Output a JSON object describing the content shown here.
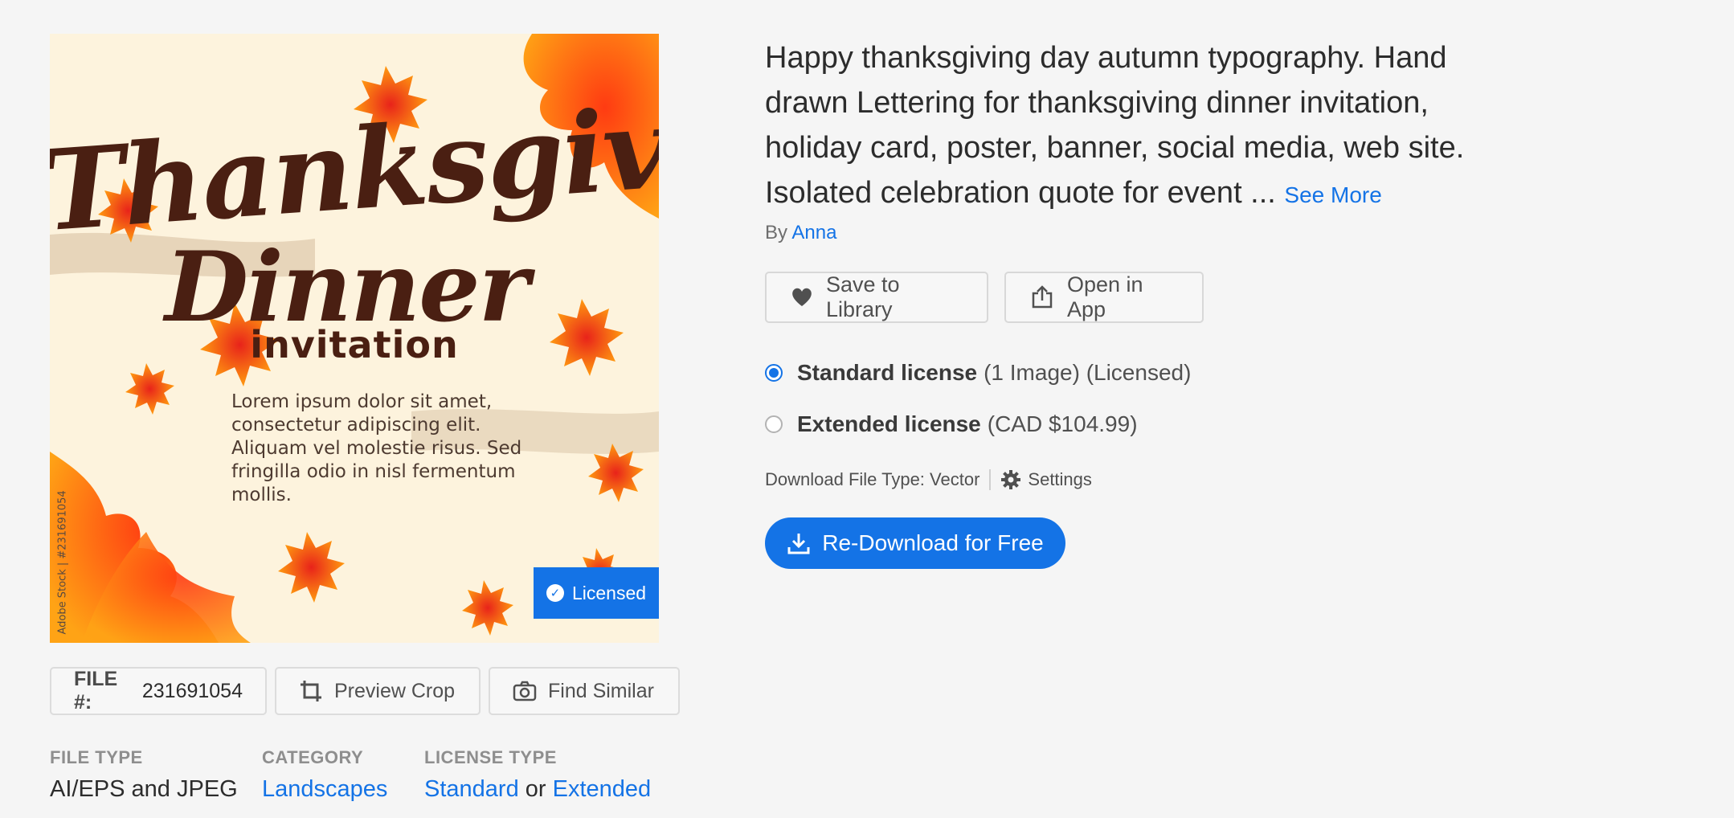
{
  "preview": {
    "headline_line1": "Thanksgiving",
    "headline_line2": "Dinner",
    "subheadline": "invitation",
    "lorem": "Lorem ipsum dolor sit amet, consectetur adipiscing elit. Aliquam vel molestie risus. Sed fringilla odio in nisl fermentum mollis.",
    "watermark": "Adobe Stock | #231691054",
    "badge_label": "Licensed",
    "badge_icon": "check-circle-icon"
  },
  "toolbar": {
    "file_label": "FILE #:",
    "file_number": "231691054",
    "preview_crop_label": "Preview Crop",
    "find_similar_label": "Find Similar"
  },
  "meta": {
    "file_type_heading": "FILE TYPE",
    "file_type_value": "AI/EPS and JPEG",
    "category_heading": "CATEGORY",
    "category_value": "Landscapes",
    "license_type_heading": "LICENSE TYPE",
    "license_standard": "Standard",
    "license_or": "or",
    "license_extended": "Extended"
  },
  "asset": {
    "title": "Happy thanksgiving day autumn typography. Hand drawn Lettering for thanksgiving dinner invitation, holiday card, poster, banner, social media, web site. Isolated celebration quote for event ...",
    "see_more": "See More",
    "by_label": "By",
    "author": "Anna"
  },
  "actions": {
    "save_label": "Save to Library",
    "open_label": "Open in App"
  },
  "licenses": [
    {
      "name": "Standard license",
      "detail": "(1 Image) (Licensed)",
      "selected": true
    },
    {
      "name": "Extended license",
      "detail": "(CAD $104.99)",
      "selected": false
    }
  ],
  "download": {
    "file_type_text": "Download File Type: Vector",
    "settings_label": "Settings",
    "redownload_label": "Re-Download for Free"
  },
  "colors": {
    "accent": "#1473e6",
    "background": "#f5f5f5",
    "text": "#2c2c2c"
  }
}
